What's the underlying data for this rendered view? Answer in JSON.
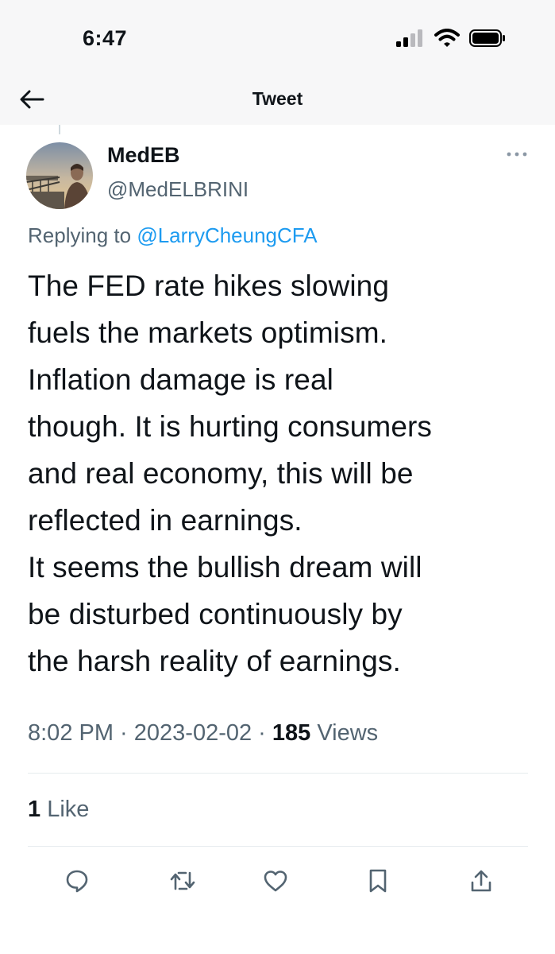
{
  "status_bar": {
    "time": "6:47",
    "icons": [
      "signal-icon",
      "wifi-icon",
      "battery-icon"
    ]
  },
  "header": {
    "title": "Tweet",
    "back_icon": "back-arrow-icon"
  },
  "tweet": {
    "author": {
      "name": "MedEB",
      "handle": "@MedELBRINI"
    },
    "reply": {
      "prefix": "Replying to ",
      "mention": "@LarryCheungCFA"
    },
    "text_lines": [
      "The FED rate hikes slowing",
      "fuels the markets optimism.",
      "Inflation damage is real",
      "though. It is hurting consumers",
      "and real economy, this will be",
      "reflected in earnings.",
      "It seems the bullish dream will",
      "be disturbed continuously by",
      "the harsh reality of earnings."
    ],
    "meta": {
      "time": "8:02 PM",
      "separator": " · ",
      "date": "2023-02-02",
      "views_count": "185",
      "views_label": " Views"
    },
    "likes": {
      "count": "1",
      "label": " Like"
    }
  },
  "actions": [
    "reply-icon",
    "retweet-icon",
    "like-icon",
    "bookmark-icon",
    "share-icon"
  ],
  "colors": {
    "accent": "#1d9bf0",
    "text": "#0f1419",
    "secondary_text": "#536471",
    "bar_background": "#f7f7f8"
  }
}
